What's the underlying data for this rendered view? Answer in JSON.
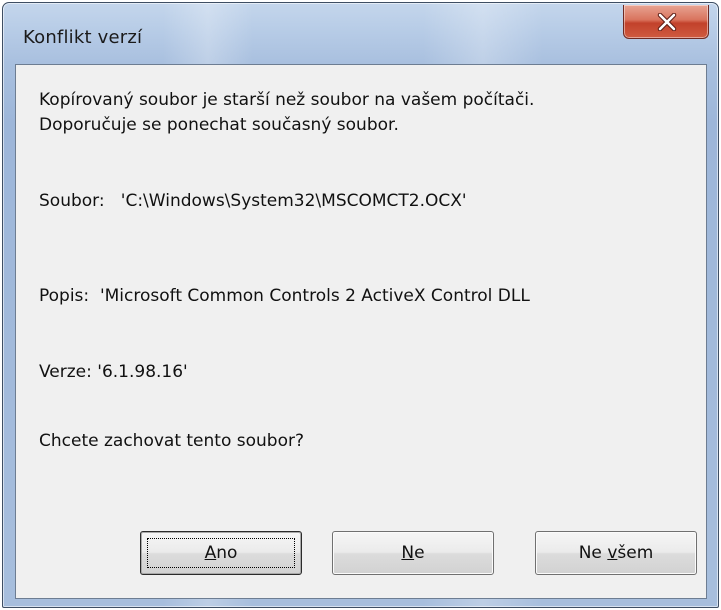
{
  "window": {
    "title": "Konflikt verzí"
  },
  "message": {
    "line1": "Kopírovaný soubor je starší než soubor na vašem počítači.",
    "line2": "Doporučuje se ponechat současný soubor."
  },
  "details": {
    "file": "Soubor:   'C:\\Windows\\System32\\MSCOMCT2.OCX'",
    "description": "Popis:  'Microsoft Common Controls 2 ActiveX Control DLL",
    "version": "Verze: '6.1.98.16'",
    "question": "Chcete zachovat tento soubor?"
  },
  "buttons": {
    "yes": {
      "mnemonic": "A",
      "rest": "no"
    },
    "no": {
      "mnemonic": "N",
      "rest": "e"
    },
    "no_all": {
      "prefix": "Ne ",
      "mnemonic": "v",
      "rest": "šem"
    }
  },
  "colors": {
    "close_button": "#c2412b",
    "frame": "#a9c0df",
    "client": "#f0f0f0"
  },
  "icons": {
    "close": "close-icon"
  }
}
